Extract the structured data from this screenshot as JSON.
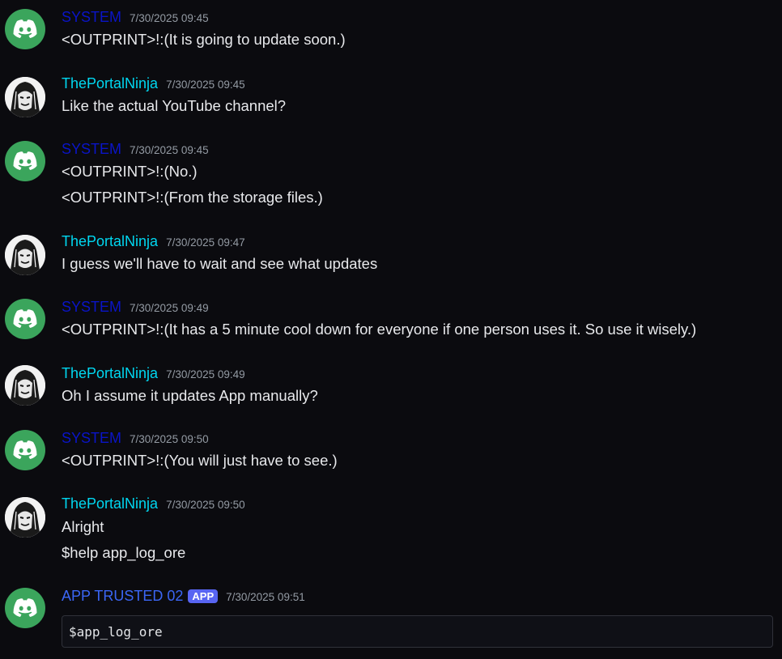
{
  "messages": [
    {
      "author": "SYSTEM",
      "timestamp": "7/30/2025 09:45",
      "lines": [
        "<OUTPRINT>!:(It is going to update soon.)"
      ]
    },
    {
      "author": "ThePortalNinja",
      "timestamp": "7/30/2025 09:45",
      "lines": [
        "Like the actual YouTube channel?"
      ]
    },
    {
      "author": "SYSTEM",
      "timestamp": "7/30/2025 09:45",
      "lines": [
        "<OUTPRINT>!:(No.)",
        "<OUTPRINT>!:(From the storage files.)"
      ]
    },
    {
      "author": "ThePortalNinja",
      "timestamp": "7/30/2025 09:47",
      "lines": [
        "I guess we'll have to wait and see what updates"
      ]
    },
    {
      "author": "SYSTEM",
      "timestamp": "7/30/2025 09:49",
      "lines": [
        "<OUTPRINT>!:(It has a 5 minute cool down for everyone if one person uses it. So use it wisely.)"
      ]
    },
    {
      "author": "ThePortalNinja",
      "timestamp": "7/30/2025 09:49",
      "lines": [
        "Oh I assume it updates App manually?"
      ]
    },
    {
      "author": "SYSTEM",
      "timestamp": "7/30/2025 09:50",
      "lines": [
        "<OUTPRINT>!:(You will just have to see.)"
      ]
    },
    {
      "author": "ThePortalNinja",
      "timestamp": "7/30/2025 09:50",
      "lines": [
        "Alright",
        "$help app_log_ore"
      ]
    },
    {
      "author": "APP TRUSTED 02",
      "badge": "APP",
      "timestamp": "7/30/2025 09:51",
      "code": "$app_log_ore"
    }
  ],
  "colors": {
    "system_name": "#0a14c8",
    "ninja_name": "#00d7f0",
    "app_name": "#3b66f5",
    "app_badge": "#5865f2",
    "system_avatar": "#3ba55c"
  },
  "icons": {
    "system_avatar": "discord-logo-icon",
    "ninja_avatar": "sketch-face-avatar"
  }
}
